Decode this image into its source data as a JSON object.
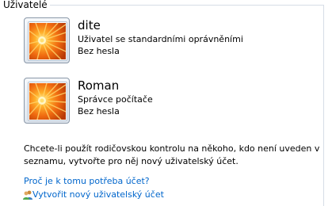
{
  "group": {
    "label": "Uživatelé"
  },
  "users": [
    {
      "name": "dite",
      "role": "Uživatel se standardními oprávněními",
      "password": "Bez hesla",
      "picture": "orange-flower-picture"
    },
    {
      "name": "Roman",
      "role": "Správce počítače",
      "password": "Bez hesla",
      "picture": "orange-flower-picture"
    }
  ],
  "info": {
    "text": "Chcete-li použít rodičovskou kontrolu na někoho, kdo není uveden v seznamu, vytvořte pro něj nový uživatelský účet."
  },
  "links": {
    "why": "Proč je k tomu potřeba účet?",
    "create": "Vytvořit nový uživatelský účet"
  },
  "colors": {
    "link": "#0066cc",
    "frame": "#d6dde6"
  }
}
